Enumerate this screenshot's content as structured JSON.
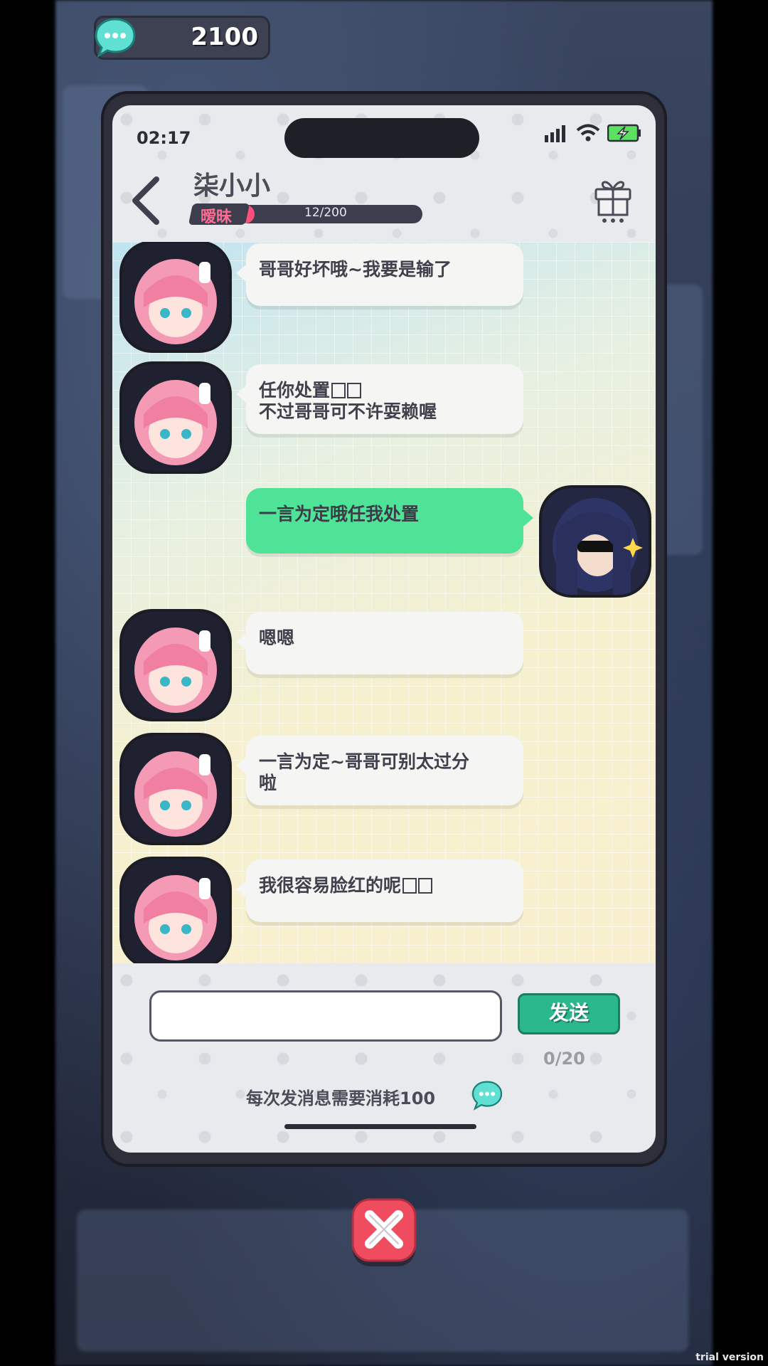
{
  "currency": {
    "amount": "2100",
    "icon": "chat-coin-icon"
  },
  "status_bar": {
    "time": "02:17"
  },
  "header": {
    "name": "柒小小",
    "relationship_tag": "暧昧",
    "affinity_text": "12/200",
    "affinity_current": 12,
    "affinity_max": 200
  },
  "messages": [
    {
      "sender": "them",
      "text": "哥哥好坏哦~我要是输了",
      "emoji": false
    },
    {
      "sender": "them",
      "line1": "任你处置",
      "line2": "不过哥哥可不许耍赖喔",
      "emoji": true
    },
    {
      "sender": "me",
      "text": "一言为定哦任我处置",
      "emoji": false
    },
    {
      "sender": "them",
      "text": "嗯嗯",
      "emoji": false
    },
    {
      "sender": "them",
      "line1": "一言为定~哥哥可别太过分",
      "line2": "啦",
      "emoji": false
    },
    {
      "sender": "them",
      "text": "我很容易脸红的呢",
      "emoji": true
    }
  ],
  "composer": {
    "placeholder": "",
    "send_label": "发送",
    "char_count": "0/20",
    "cost_note": "每次发消息需要消耗100"
  },
  "watermark": "trial version",
  "colors": {
    "accent_green": "#4fe397",
    "send_green": "#2bb98c",
    "affinity_pink": "#ff4f7a",
    "close_red": "#ef4d5f"
  }
}
